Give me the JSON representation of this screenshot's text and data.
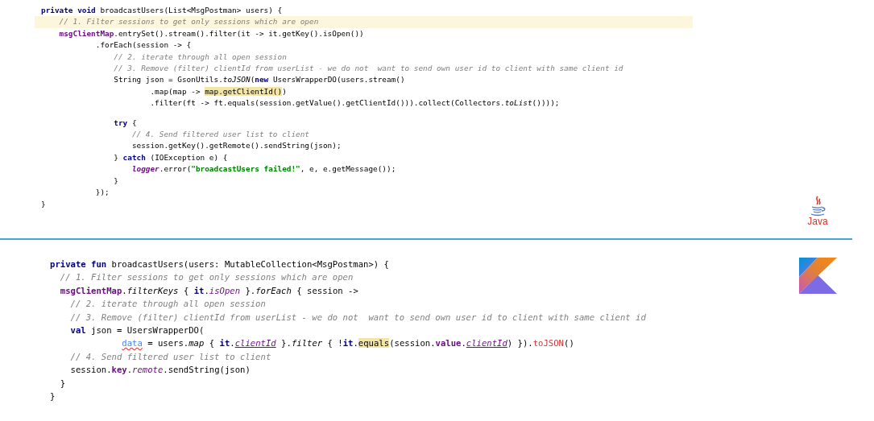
{
  "sections": [
    {
      "kind": "java",
      "logo": {
        "kind": "java",
        "label": "Java"
      },
      "lines": [
        {
          "highlighted": false,
          "tokens": [
            {
              "kind": "keyword",
              "text": "private void"
            },
            {
              "kind": "plain",
              "text": " broadcastUsers(List<MsgPostman> users) {"
            }
          ]
        },
        {
          "highlighted": true,
          "tokens": [
            {
              "kind": "comment",
              "text": "    // 1. Filter sessions to get only sessions which are open"
            }
          ]
        },
        {
          "highlighted": false,
          "tokens": [
            {
              "kind": "field",
              "text": "    msgClientMap"
            },
            {
              "kind": "plain",
              "text": ".entrySet().stream().filter(it -> it.getKey().isOpen())"
            }
          ]
        },
        {
          "highlighted": false,
          "tokens": [
            {
              "kind": "plain",
              "text": "            .forEach(session -> {"
            }
          ]
        },
        {
          "highlighted": false,
          "tokens": [
            {
              "kind": "comment",
              "text": "                // 2. iterate through all open session"
            }
          ]
        },
        {
          "highlighted": false,
          "tokens": [
            {
              "kind": "comment",
              "text": "                // 3. Remove (filter) clientId from userList - we do not  want to send own user id to client with same client id"
            }
          ]
        },
        {
          "highlighted": false,
          "tokens": [
            {
              "kind": "plain",
              "text": "                String json = GsonUtils."
            },
            {
              "kind": "static",
              "text": "toJSON"
            },
            {
              "kind": "plain",
              "text": "("
            },
            {
              "kind": "keyword",
              "text": "new"
            },
            {
              "kind": "plain",
              "text": " UsersWrapperDO(users.stream()"
            }
          ]
        },
        {
          "highlighted": false,
          "tokens": [
            {
              "kind": "plain",
              "text": "                        .map(map -> "
            },
            {
              "kind": "match",
              "text": "map.getClientId()"
            },
            {
              "kind": "plain",
              "text": ")"
            }
          ]
        },
        {
          "highlighted": false,
          "tokens": [
            {
              "kind": "plain",
              "text": "                        .filter(ft -> ft.equals(session.getValue().getClientId())).collect(Collectors."
            },
            {
              "kind": "static",
              "text": "toList"
            },
            {
              "kind": "plain",
              "text": "())));"
            }
          ]
        },
        {
          "highlighted": false,
          "space_above": true,
          "tokens": [
            {
              "kind": "keyword",
              "text": "                try"
            },
            {
              "kind": "plain",
              "text": " {"
            }
          ]
        },
        {
          "highlighted": false,
          "tokens": [
            {
              "kind": "comment",
              "text": "                    // 4. Send filtered user list to client"
            }
          ]
        },
        {
          "highlighted": false,
          "tokens": [
            {
              "kind": "plain",
              "text": "                    session.getKey().getRemote().sendString(json);"
            }
          ]
        },
        {
          "highlighted": false,
          "tokens": [
            {
              "kind": "plain",
              "text": "                } "
            },
            {
              "kind": "keyword",
              "text": "catch"
            },
            {
              "kind": "plain",
              "text": " (IOException e) {"
            }
          ]
        },
        {
          "highlighted": false,
          "tokens": [
            {
              "kind": "static-field",
              "text": "                    logger"
            },
            {
              "kind": "plain",
              "text": ".error("
            },
            {
              "kind": "string",
              "text": "\"broadcastUsers failed!\""
            },
            {
              "kind": "plain",
              "text": ", e, e.getMessage());"
            }
          ]
        },
        {
          "highlighted": false,
          "tokens": [
            {
              "kind": "plain",
              "text": "                }"
            }
          ]
        },
        {
          "highlighted": false,
          "tokens": [
            {
              "kind": "plain",
              "text": "            });"
            }
          ]
        },
        {
          "highlighted": false,
          "tokens": [
            {
              "kind": "plain",
              "text": "}"
            }
          ]
        }
      ]
    },
    {
      "kind": "kotlin",
      "logo": {
        "kind": "kotlin"
      },
      "lines": [
        {
          "highlighted": false,
          "tokens": [
            {
              "kind": "keyword",
              "text": "private fun"
            },
            {
              "kind": "plain",
              "text": " broadcastUsers(users: MutableCollection<MsgPostman>) {"
            }
          ]
        },
        {
          "highlighted": false,
          "tokens": [
            {
              "kind": "comment",
              "text": "  // 1. Filter sessions to get only sessions which are open"
            }
          ]
        },
        {
          "highlighted": false,
          "tokens": [
            {
              "kind": "field",
              "text": "  msgClientMap"
            },
            {
              "kind": "plain",
              "text": "."
            },
            {
              "kind": "extension",
              "text": "filterKeys"
            },
            {
              "kind": "plain",
              "text": " { "
            },
            {
              "kind": "keyword",
              "text": "it"
            },
            {
              "kind": "plain",
              "text": "."
            },
            {
              "kind": "property",
              "text": "isOpen"
            },
            {
              "kind": "plain",
              "text": " }."
            },
            {
              "kind": "extension",
              "text": "forEach"
            },
            {
              "kind": "plain",
              "text": " { session ->"
            }
          ]
        },
        {
          "highlighted": false,
          "tokens": [
            {
              "kind": "comment",
              "text": "    // 2. iterate through all open session"
            }
          ]
        },
        {
          "highlighted": false,
          "tokens": [
            {
              "kind": "comment",
              "text": "    // 3. Remove (filter) clientId from userList - we do not  want to send own user id to client with same client id"
            }
          ]
        },
        {
          "highlighted": false,
          "tokens": [
            {
              "kind": "keyword",
              "text": "    val"
            },
            {
              "kind": "plain",
              "text": " json = UsersWrapperDO("
            }
          ]
        },
        {
          "highlighted": false,
          "tokens": [
            {
              "kind": "named-arg-error",
              "text": "              data"
            },
            {
              "kind": "plain",
              "text": " = users."
            },
            {
              "kind": "extension",
              "text": "map"
            },
            {
              "kind": "plain",
              "text": " { "
            },
            {
              "kind": "keyword",
              "text": "it"
            },
            {
              "kind": "plain",
              "text": "."
            },
            {
              "kind": "synthetic",
              "text": "clientId"
            },
            {
              "kind": "plain",
              "text": " }."
            },
            {
              "kind": "extension",
              "text": "filter"
            },
            {
              "kind": "plain",
              "text": " { !"
            },
            {
              "kind": "keyword",
              "text": "it"
            },
            {
              "kind": "plain",
              "text": "."
            },
            {
              "kind": "match",
              "text": "equals"
            },
            {
              "kind": "plain",
              "text": "(session."
            },
            {
              "kind": "field",
              "text": "value"
            },
            {
              "kind": "plain",
              "text": "."
            },
            {
              "kind": "synthetic",
              "text": "clientId"
            },
            {
              "kind": "plain",
              "text": ") })."
            },
            {
              "kind": "call-red",
              "text": "toJSON"
            },
            {
              "kind": "plain",
              "text": "()"
            }
          ]
        },
        {
          "highlighted": false,
          "tokens": [
            {
              "kind": "comment",
              "text": "    // 4. Send filtered user list to client"
            }
          ]
        },
        {
          "highlighted": false,
          "tokens": [
            {
              "kind": "plain",
              "text": "    session."
            },
            {
              "kind": "field",
              "text": "key"
            },
            {
              "kind": "plain",
              "text": "."
            },
            {
              "kind": "property",
              "text": "remote"
            },
            {
              "kind": "plain",
              "text": ".sendString(json)"
            }
          ]
        },
        {
          "highlighted": false,
          "tokens": [
            {
              "kind": "plain",
              "text": "  }"
            }
          ]
        },
        {
          "highlighted": false,
          "tokens": [
            {
              "kind": "plain",
              "text": "}"
            }
          ]
        }
      ]
    }
  ]
}
